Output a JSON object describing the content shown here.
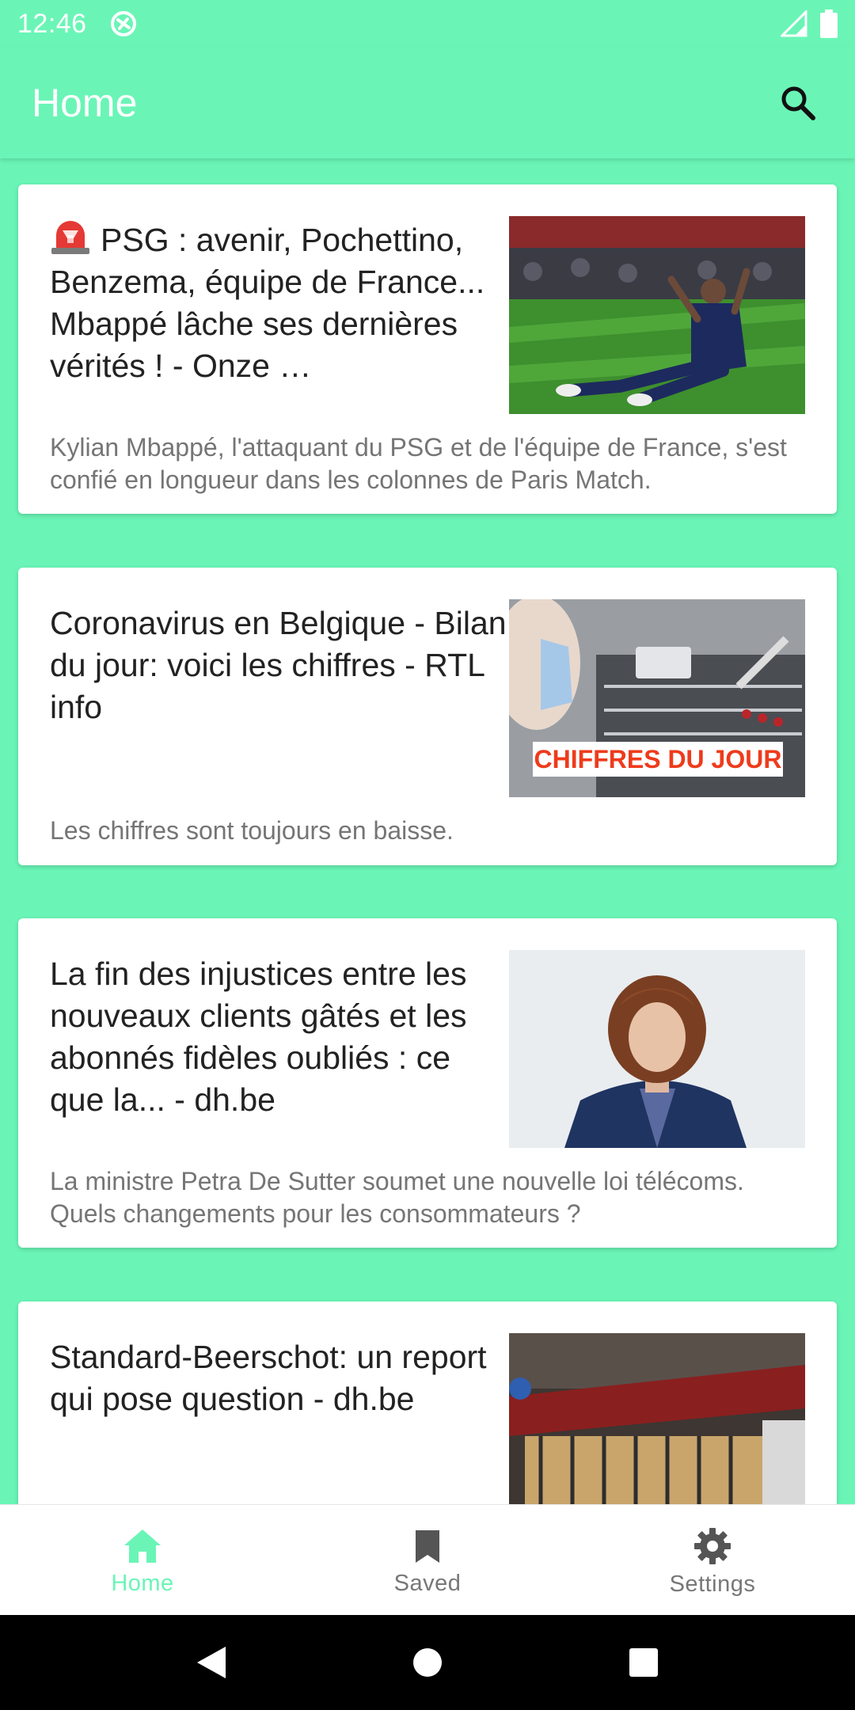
{
  "status_bar": {
    "time": "12:46"
  },
  "app_bar": {
    "title": "Home"
  },
  "articles": [
    {
      "title": "PSG : avenir, Pochettino, Benzema, équipe de France... Mbappé lâche ses dernières vérités ! - Onze …",
      "description": "Kylian Mbappé, l'attaquant du PSG et de l'équipe de France, s'est confié en longueur dans les colonnes de Paris Match.",
      "icon": "siren-emoji"
    },
    {
      "title": "Coronavirus en Belgique - Bilan du jour: voici les chiffres - RTL info",
      "description": "Les chiffres sont toujours en baisse.",
      "thumb_caption": "CHIFFRES DU JOUR"
    },
    {
      "title": "La fin des injustices entre les nouveaux clients gâtés et les abonnés fidèles oubliés : ce que la... - dh.be",
      "description": "La ministre Petra De Sutter soumet une nouvelle loi télécoms. Quels changements pour les consommateurs ?"
    },
    {
      "title": "Standard-Beerschot: un report qui pose question - dh.be",
      "description": ""
    }
  ],
  "bottom_nav": {
    "items": [
      {
        "label": "Home",
        "icon": "home-icon",
        "active": true
      },
      {
        "label": "Saved",
        "icon": "bookmark-icon",
        "active": false
      },
      {
        "label": "Settings",
        "icon": "gear-icon",
        "active": false
      }
    ]
  },
  "colors": {
    "accent": "#6af5b6",
    "title_text": "#222222",
    "desc_text": "#757575"
  }
}
